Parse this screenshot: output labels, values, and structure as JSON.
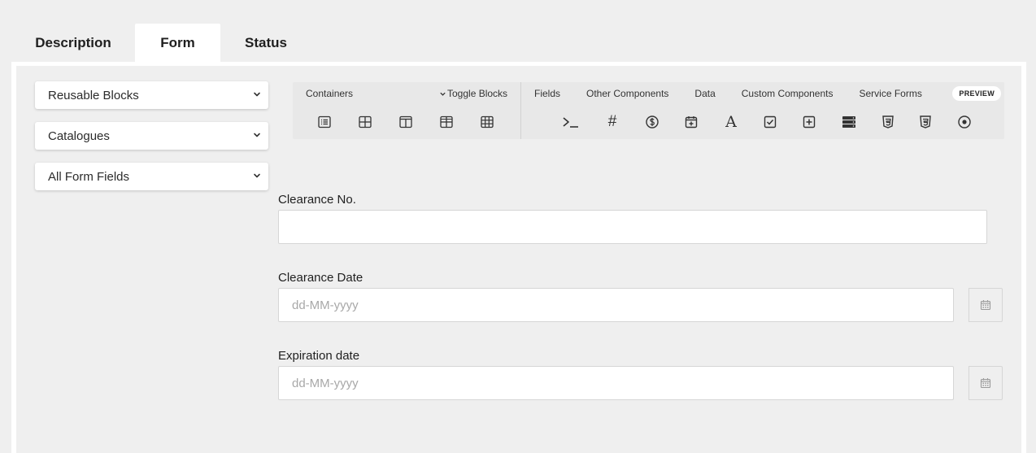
{
  "tabs": [
    {
      "label": "Description"
    },
    {
      "label": "Form",
      "active": true
    },
    {
      "label": "Status"
    }
  ],
  "sidebar": {
    "selects": [
      {
        "value": "Reusable Blocks"
      },
      {
        "value": "Catalogues"
      },
      {
        "value": "All Form Fields"
      }
    ]
  },
  "builder": {
    "containers_label": "Containers",
    "toggle_label": "Toggle Blocks",
    "tabs": [
      {
        "label": "Fields",
        "active": true
      },
      {
        "label": "Other Components"
      },
      {
        "label": "Data"
      },
      {
        "label": "Custom Components"
      },
      {
        "label": "Service Forms"
      }
    ],
    "preview_label": "PREVIEW",
    "container_icons": [
      "list-panel-icon",
      "table-icon",
      "columns-icon",
      "grid-icon",
      "data-grid-icon"
    ],
    "field_icons": [
      "textfield-icon",
      "number-icon",
      "currency-icon",
      "datetime-icon",
      "textarea-icon",
      "checkbox-icon",
      "select-icon",
      "select-boxes-icon",
      "html-icon",
      "html-icon-2",
      "radio-icon"
    ],
    "number_glyph": "#",
    "textarea_glyph": "A"
  },
  "form": {
    "clearance_no": {
      "label": "Clearance No.",
      "value": "",
      "placeholder": ""
    },
    "clearance_date": {
      "label": "Clearance Date",
      "placeholder": "dd-MM-yyyy"
    },
    "expiration_date": {
      "label": "Expiration date",
      "placeholder": "dd-MM-yyyy"
    }
  },
  "colors": {
    "background": "#efefef",
    "panel": "#ffffff",
    "toolbar": "#e8e8e8"
  }
}
